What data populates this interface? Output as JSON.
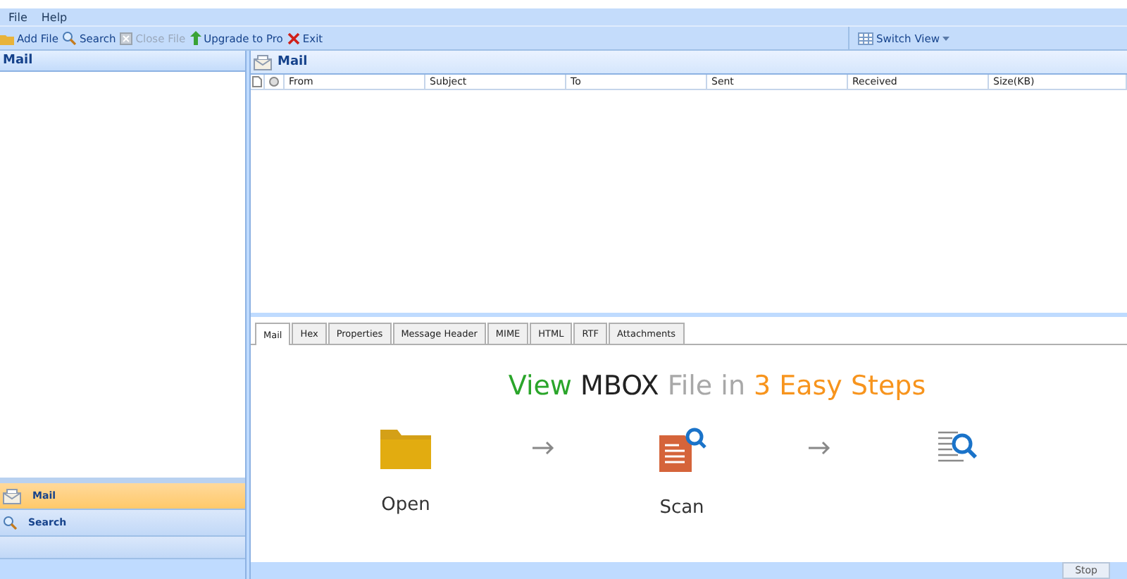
{
  "menu": [
    "File",
    "Help"
  ],
  "toolbar": [
    {
      "label": "Add File",
      "kind": "folder",
      "disabled": false
    },
    {
      "label": "Search",
      "kind": "search",
      "disabled": false
    },
    {
      "label": "Close File",
      "kind": "close",
      "disabled": true
    },
    {
      "label": "Upgrade to Pro",
      "kind": "upgrade",
      "disabled": false
    },
    {
      "label": "Exit",
      "kind": "exit",
      "disabled": false
    }
  ],
  "switch_view": "Switch View",
  "left_panel": {
    "title": "Mail",
    "nav": [
      {
        "label": "Mail",
        "kind": "mail",
        "selected": true
      },
      {
        "label": "Search",
        "kind": "search",
        "selected": false
      }
    ]
  },
  "mail_panel": {
    "title": "Mail",
    "columns": [
      "From",
      "Subject",
      "To",
      "Sent",
      "Received",
      "Size(KB)"
    ]
  },
  "tabs": [
    {
      "label": "Mail",
      "selected": true
    },
    {
      "label": "Hex",
      "selected": false
    },
    {
      "label": "Properties",
      "selected": false
    },
    {
      "label": "Message Header",
      "selected": false
    },
    {
      "label": "MIME",
      "selected": false
    },
    {
      "label": "HTML",
      "selected": false
    },
    {
      "label": "RTF",
      "selected": false
    },
    {
      "label": "Attachments",
      "selected": false
    }
  ],
  "headline": [
    {
      "text": "View",
      "color": "#2aa52a"
    },
    {
      "text": "MBOX",
      "color": "#222222"
    },
    {
      "text": "File in",
      "color": "#a8a8a8"
    },
    {
      "text": "3 Easy Steps",
      "color": "#f7941d"
    }
  ],
  "steps": [
    {
      "kind": "open",
      "label": "Open"
    },
    {
      "kind": "scan",
      "label": "Scan"
    },
    {
      "kind": "view"
    }
  ],
  "stop_button": "Stop"
}
